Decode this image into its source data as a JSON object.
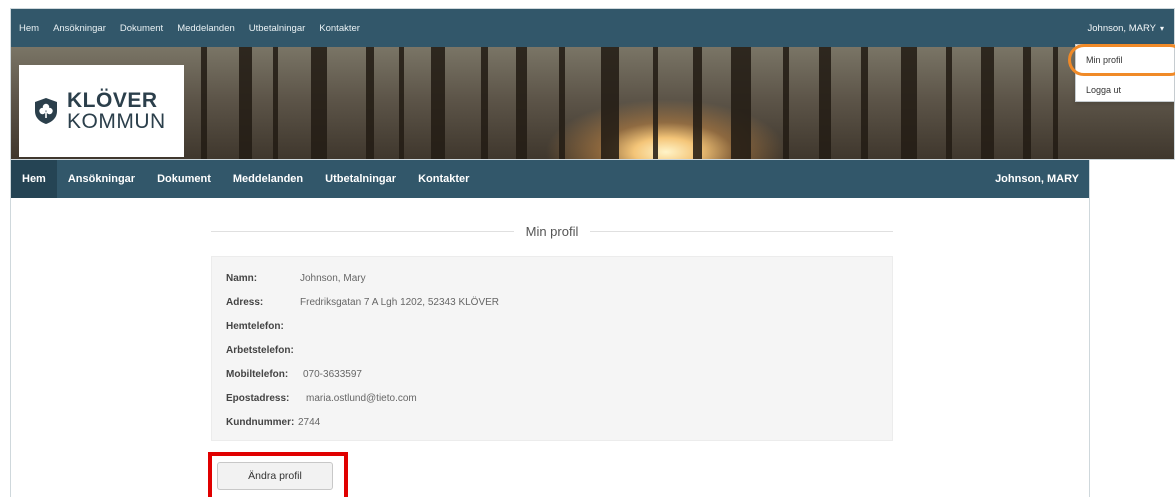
{
  "background_screen": {
    "nav_items": [
      "Hem",
      "Ansökningar",
      "Dokument",
      "Meddelanden",
      "Utbetalningar",
      "Kontakter"
    ],
    "user_name": "Johnson, MARY",
    "caret": "▾",
    "logo": {
      "line1": "KLÖVER",
      "line2": "KOMMUN"
    },
    "user_menu": {
      "items": [
        "Min profil",
        "Logga ut"
      ]
    }
  },
  "foreground_screen": {
    "nav_items": [
      "Hem",
      "Ansökningar",
      "Dokument",
      "Meddelanden",
      "Utbetalningar",
      "Kontakter"
    ],
    "active_nav": "Hem",
    "user_name": "Johnson, MARY",
    "section_title": "Min profil",
    "profile": [
      {
        "label": "Namn:",
        "value": "Johnson, Mary"
      },
      {
        "label": "Adress:",
        "value": "Fredriksgatan 7 A Lgh 1202, 52343 KLÖVER"
      },
      {
        "label": "Hemtelefon:",
        "value": ""
      },
      {
        "label": "Arbetstelefon:",
        "value": ""
      },
      {
        "label": "Mobiltelefon:",
        "value": "070-3633597"
      },
      {
        "label": "Epostadress:",
        "value": "maria.ostlund@tieto.com"
      },
      {
        "label": "Kundnummer:",
        "value": "2744"
      }
    ],
    "edit_button_label": "Ändra profil"
  },
  "annotation_colors": {
    "highlight_orange": "#f08a28",
    "highlight_red": "#e00000"
  },
  "theme": {
    "nav_bg": "#32576a",
    "nav_active_bg": "#254454"
  }
}
